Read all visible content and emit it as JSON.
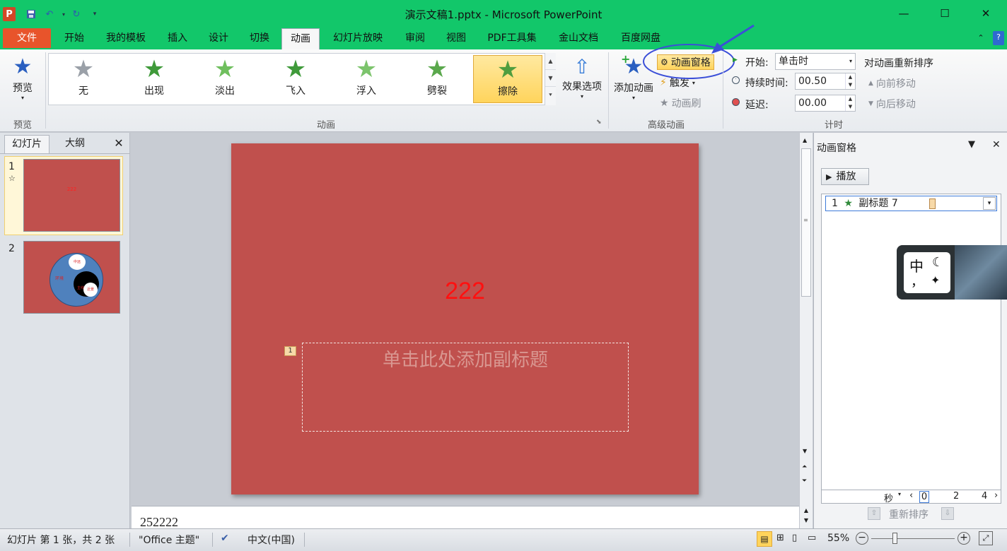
{
  "window": {
    "title": "演示文稿1.pptx - Microsoft PowerPoint",
    "colors": {
      "titlebar": "#12c76a",
      "file_tab": "#e8542b",
      "slide_bg": "#c0504d",
      "highlight": "#ffd45c",
      "annotation": "#3b4fd8"
    }
  },
  "tabs": [
    "文件",
    "开始",
    "我的模板",
    "插入",
    "设计",
    "切换",
    "动画",
    "幻灯片放映",
    "审阅",
    "视图",
    "PDF工具集",
    "金山文档",
    "百度网盘"
  ],
  "ribbon": {
    "preview": {
      "label": "预览",
      "group": "预览"
    },
    "animations": {
      "group": "动画",
      "items": [
        {
          "label": "无",
          "icon": "star-gray-icon"
        },
        {
          "label": "出现",
          "icon": "star-green-icon"
        },
        {
          "label": "淡出",
          "icon": "star-green-icon"
        },
        {
          "label": "飞入",
          "icon": "star-green-icon"
        },
        {
          "label": "浮入",
          "icon": "star-green-icon"
        },
        {
          "label": "劈裂",
          "icon": "star-green-icon"
        },
        {
          "label": "擦除",
          "icon": "star-green-icon",
          "selected": true
        }
      ],
      "effect_options": "效果选项"
    },
    "advanced": {
      "group": "高级动画",
      "add_animation": "添加动画",
      "animation_pane": "动画窗格",
      "trigger": "触发",
      "animation_painter": "动画刷"
    },
    "timing": {
      "group": "计时",
      "start_label": "开始:",
      "start_value": "单击时",
      "duration_label": "持续时间:",
      "duration_value": "00.50",
      "delay_label": "延迟:",
      "delay_value": "00.00",
      "reorder": "对动画重新排序",
      "move_earlier": "向前移动",
      "move_later": "向后移动"
    }
  },
  "left_panel": {
    "tabs": [
      "幻灯片",
      "大纲"
    ],
    "slides": [
      {
        "number": "1",
        "text": "222",
        "anim_marker": "☆"
      },
      {
        "number": "2",
        "labels": [
          "中远",
          "环境",
          "主线",
          "近景"
        ]
      }
    ]
  },
  "slide": {
    "title_text": "222",
    "subtitle_placeholder": "单击此处添加副标题",
    "anim_tag": "1"
  },
  "notes": {
    "text": "252222"
  },
  "animation_pane": {
    "title": "动画窗格",
    "play": "播放",
    "items": [
      {
        "number": "1",
        "name": "副标题 7"
      }
    ],
    "timeline": {
      "unit": "秒",
      "ticks": [
        "0",
        "2",
        "4"
      ]
    },
    "reorder": "重新排序"
  },
  "ime": {
    "char1": "中",
    "char2": "，"
  },
  "status": {
    "slide_info": "幻灯片 第 1 张，共 2 张",
    "theme": "\"Office 主题\"",
    "language": "中文(中国)",
    "zoom": "55%"
  }
}
